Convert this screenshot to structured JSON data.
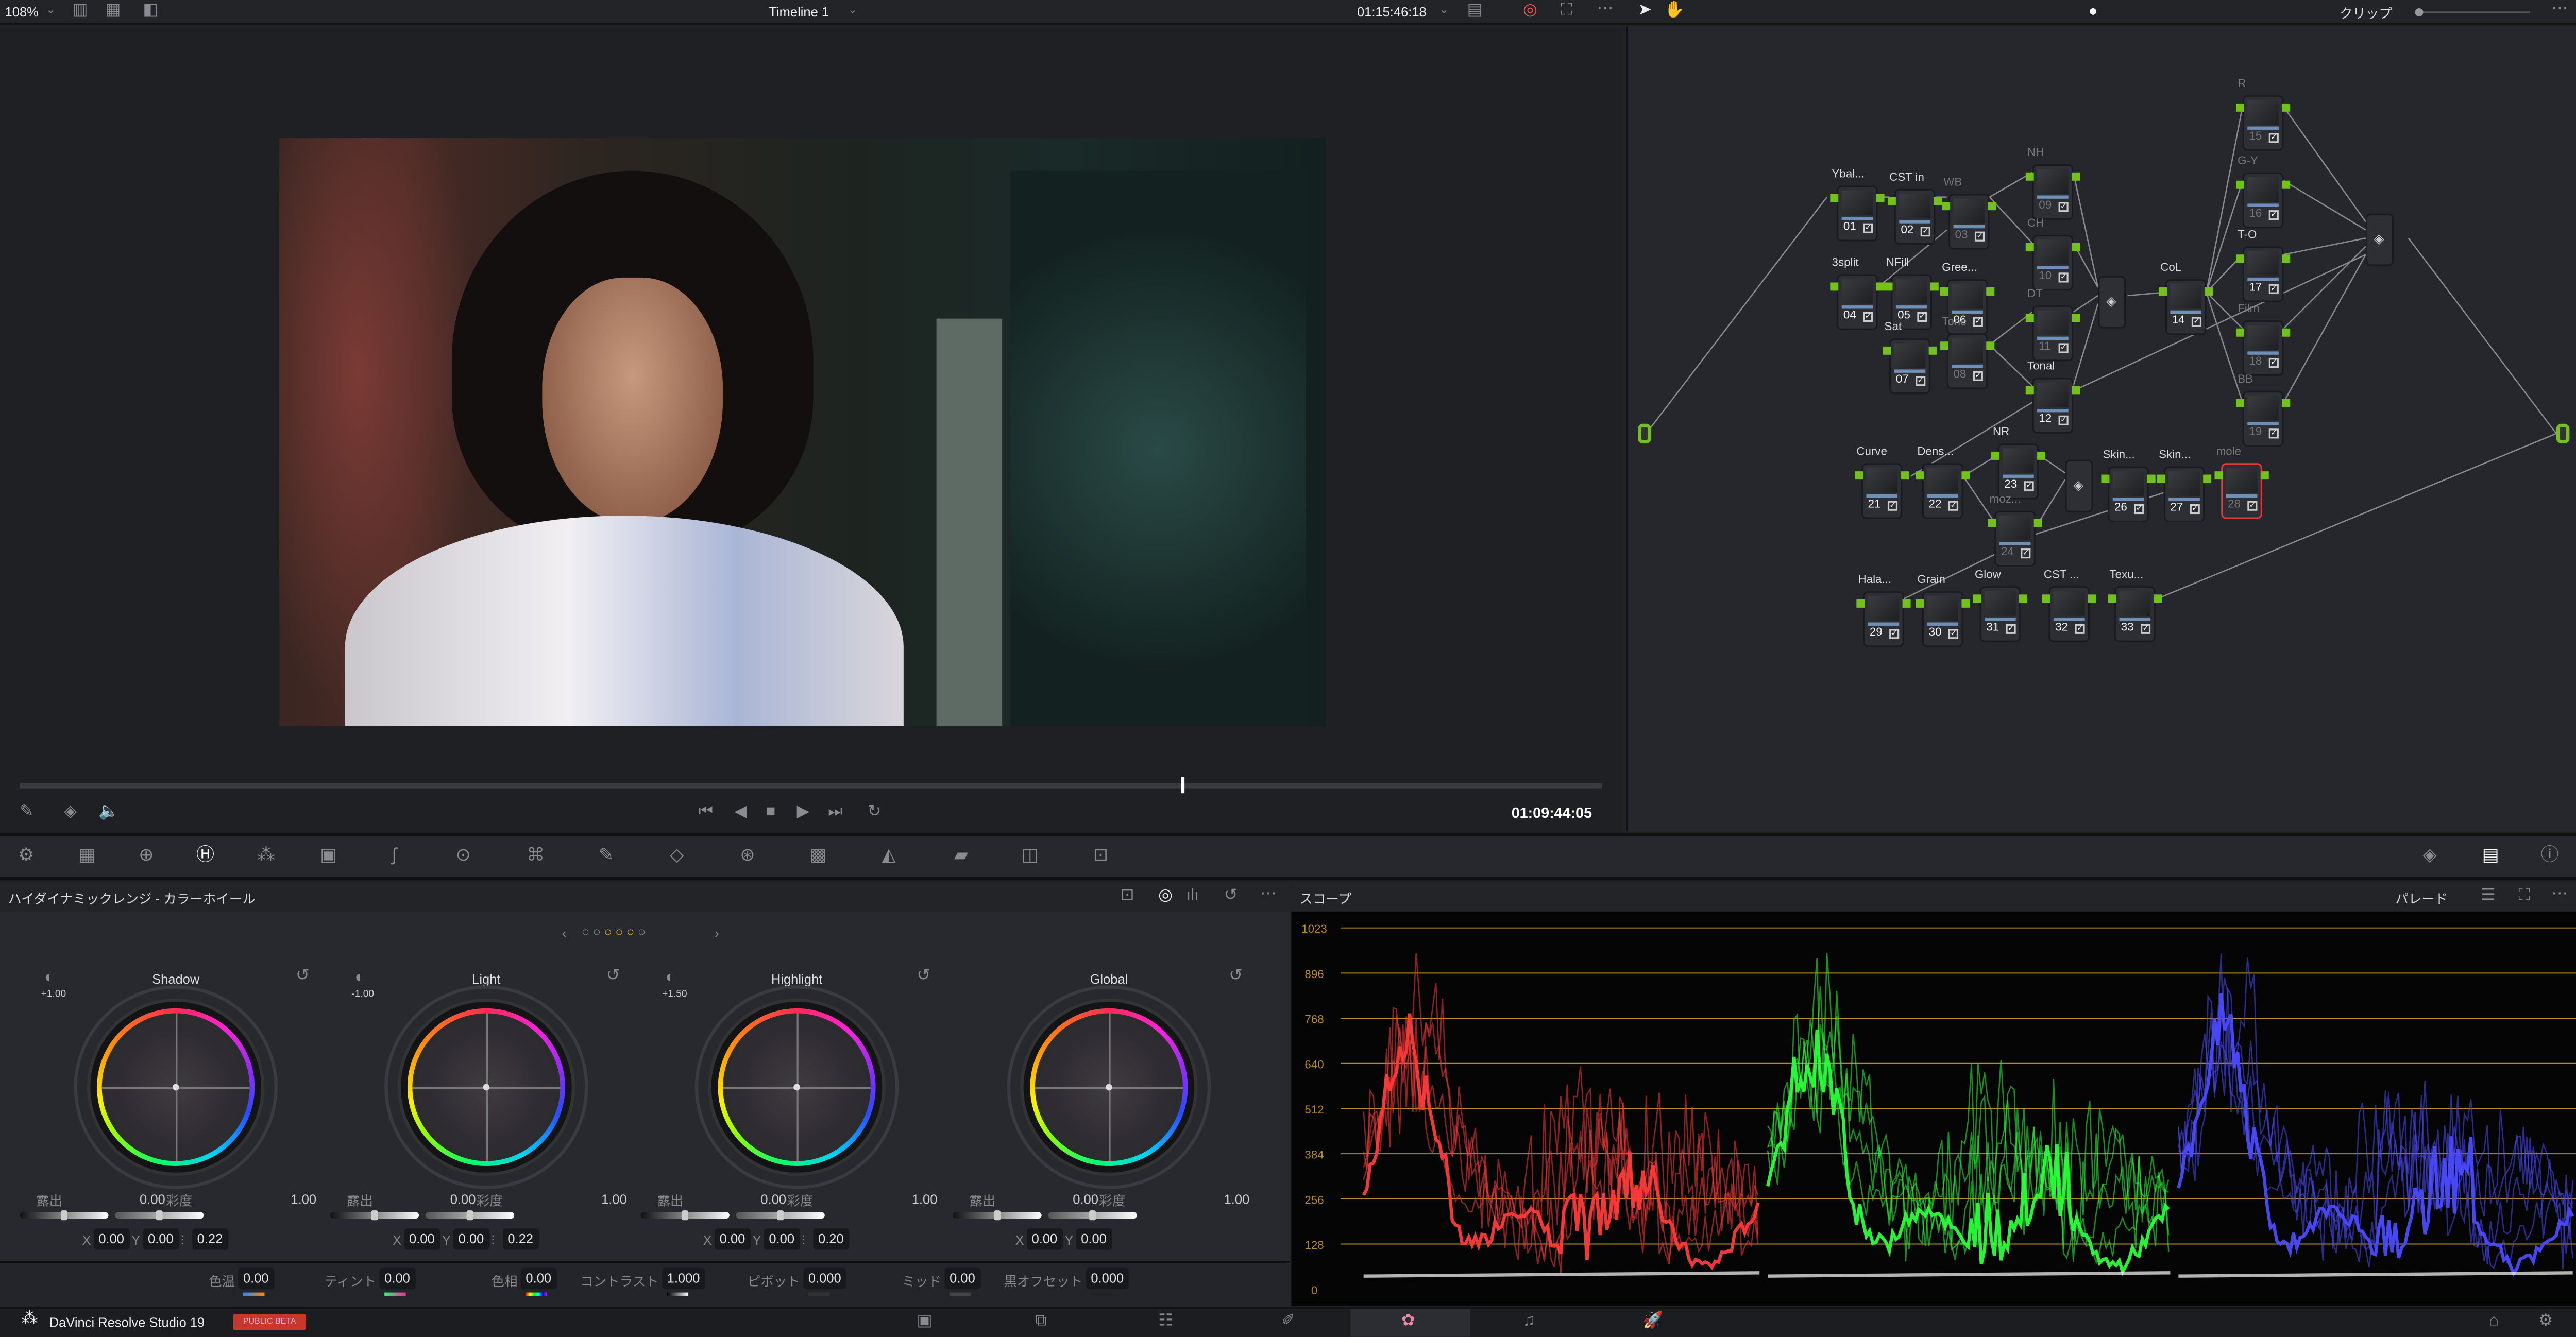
{
  "topbar": {
    "zoom": "108%",
    "timeline": "Timeline 1",
    "timecode": "01:15:46:18",
    "node_mode": "クリップ"
  },
  "viewer": {
    "current_timecode": "01:09:44:05",
    "playhead_fraction": 0.73
  },
  "nodes": [
    {
      "num": "01",
      "label": "Ybal..."
    },
    {
      "num": "02",
      "label": "CST in"
    },
    {
      "num": "03",
      "label": "WB",
      "off": true
    },
    {
      "num": "04",
      "label": "3split"
    },
    {
      "num": "05",
      "label": "NFill"
    },
    {
      "num": "06",
      "label": "Gree..."
    },
    {
      "num": "07",
      "label": "Sat"
    },
    {
      "num": "08",
      "label": "Tone",
      "off": true
    },
    {
      "num": "09",
      "label": "NH",
      "off": true
    },
    {
      "num": "10",
      "label": "CH",
      "off": true
    },
    {
      "num": "11",
      "label": "DT",
      "off": true
    },
    {
      "num": "12",
      "label": "Tonal"
    },
    {
      "num": "14",
      "label": "CoL"
    },
    {
      "num": "15",
      "label": "R",
      "off": true
    },
    {
      "num": "16",
      "label": "G-Y",
      "off": true
    },
    {
      "num": "17",
      "label": "T-O"
    },
    {
      "num": "18",
      "label": "Film",
      "off": true
    },
    {
      "num": "19",
      "label": "BB",
      "off": true
    },
    {
      "num": "21",
      "label": "Curve"
    },
    {
      "num": "22",
      "label": "Dens..."
    },
    {
      "num": "23",
      "label": "NR"
    },
    {
      "num": "24",
      "label": "moz...",
      "off": true
    },
    {
      "num": "26",
      "label": "Skin..."
    },
    {
      "num": "27",
      "label": "Skin..."
    },
    {
      "num": "28",
      "label": "mole",
      "off": true,
      "selected": true
    },
    {
      "num": "29",
      "label": "Hala..."
    },
    {
      "num": "30",
      "label": "Grain"
    },
    {
      "num": "31",
      "label": "Glow"
    },
    {
      "num": "32",
      "label": "CST ..."
    },
    {
      "num": "33",
      "label": "Texu..."
    }
  ],
  "panel": {
    "title": "ハイダイナミックレンジ - カラーホイール",
    "scope_title": "スコープ",
    "scope_mode": "パレード"
  },
  "wheels": [
    {
      "name": "Shadow",
      "zone": "+1.00",
      "exposure_label": "露出",
      "exposure": "0.00",
      "sat_label": "彩度",
      "sat": "1.00",
      "x": "0.00",
      "y": "0.00",
      "falloff": "0.22"
    },
    {
      "name": "Light",
      "zone": "-1.00",
      "exposure_label": "露出",
      "exposure": "0.00",
      "sat_label": "彩度",
      "sat": "1.00",
      "x": "0.00",
      "y": "0.00",
      "falloff": "0.22"
    },
    {
      "name": "Highlight",
      "zone": "+1.50",
      "exposure_label": "露出",
      "exposure": "0.00",
      "sat_label": "彩度",
      "sat": "1.00",
      "x": "0.00",
      "y": "0.00",
      "falloff": "0.20"
    },
    {
      "name": "Global",
      "exposure_label": "露出",
      "exposure": "0.00",
      "sat_label": "彩度",
      "sat": "1.00",
      "x": "0.00",
      "y": "0.00"
    }
  ],
  "xy_labels": {
    "x": "X",
    "y": "Y"
  },
  "adjustments": [
    {
      "label": "色温",
      "value": "0.00"
    },
    {
      "label": "ティント",
      "value": "0.00"
    },
    {
      "label": "色相",
      "value": "0.00"
    },
    {
      "label": "コントラスト",
      "value": "1.000"
    },
    {
      "label": "ピボット",
      "value": "0.000"
    },
    {
      "label": "ミッド",
      "value": "0.00"
    },
    {
      "label": "黒オフセット",
      "value": "0.000"
    }
  ],
  "scope": {
    "ticks": [
      "1023",
      "896",
      "768",
      "640",
      "512",
      "384",
      "256",
      "128",
      "0"
    ],
    "grid_color": "#b98a1c",
    "channels": [
      "#ff3a3a",
      "#2aff3a",
      "#4a4aff"
    ]
  },
  "footer": {
    "app": "DaVinci Resolve Studio 19",
    "badge": "PUBLIC BETA",
    "badge_color": "#c9372c"
  }
}
